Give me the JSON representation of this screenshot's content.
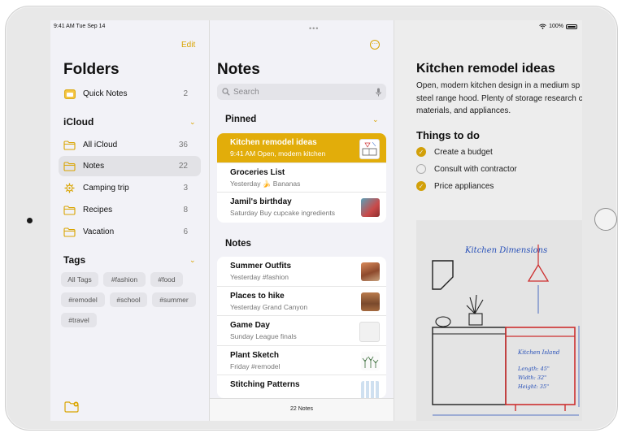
{
  "status": {
    "time": "9:41 AM  Tue Sep 14",
    "battery": "100%"
  },
  "sidebar": {
    "edit_label": "Edit",
    "title": "Folders",
    "quick_notes": {
      "label": "Quick Notes",
      "count": "2"
    },
    "icloud_header": "iCloud",
    "items": [
      {
        "label": "All iCloud",
        "count": "36",
        "icon": "folder-icon"
      },
      {
        "label": "Notes",
        "count": "22",
        "icon": "folder-icon",
        "selected": true
      },
      {
        "label": "Camping trip",
        "count": "3",
        "icon": "gear-icon"
      },
      {
        "label": "Recipes",
        "count": "8",
        "icon": "folder-icon"
      },
      {
        "label": "Vacation",
        "count": "6",
        "icon": "folder-icon"
      }
    ],
    "tags_header": "Tags",
    "tags": [
      "All Tags",
      "#fashion",
      "#food",
      "#remodel",
      "#school",
      "#summer",
      "#travel"
    ]
  },
  "notes_list": {
    "title": "Notes",
    "search_placeholder": "Search",
    "pinned_header": "Pinned",
    "pinned": [
      {
        "title": "Kitchen remodel ideas",
        "subtitle": "9:41 AM  Open, modern kitchen"
      },
      {
        "title": "Groceries List",
        "subtitle": "Yesterday 🍌 Bananas"
      },
      {
        "title": "Jamil's birthday",
        "subtitle": "Saturday Buy cupcake ingredients"
      }
    ],
    "notes_header": "Notes",
    "notes": [
      {
        "title": "Summer Outfits",
        "subtitle": "Yesterday #fashion"
      },
      {
        "title": "Places to hike",
        "subtitle": "Yesterday Grand Canyon"
      },
      {
        "title": "Game Day",
        "subtitle": "Sunday League finals"
      },
      {
        "title": "Plant Sketch",
        "subtitle": "Friday #remodel"
      },
      {
        "title": "Stitching Patterns",
        "subtitle": ""
      }
    ],
    "footer_count": "22 Notes"
  },
  "detail": {
    "title": "Kitchen remodel ideas",
    "body": "Open, modern kitchen design in a medium sp Stainless steel range hood. Plenty of storage research colors, materials, and appliances.",
    "todo_header": "Things to do",
    "todos": [
      {
        "label": "Create a budget",
        "done": true
      },
      {
        "label": "Consult with contractor",
        "done": false
      },
      {
        "label": "Price appliances",
        "done": true
      }
    ],
    "sketch_labels": {
      "kitchen_dimensions": "Kitchen Dimensions",
      "kitchen_island": "Kitchen Island",
      "length": "Length: 45\"",
      "width": "Width: 32\"",
      "height": "Height: 35\""
    }
  },
  "colors": {
    "accent": "#e2ad0a",
    "selected_row": "#e2ad0a",
    "sidebar_bg": "#f2f2f7"
  }
}
